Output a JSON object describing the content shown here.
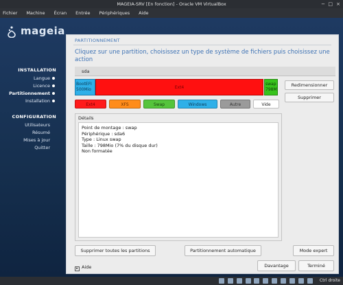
{
  "window": {
    "title": "MAGEIA-SRV [En fonction] - Oracle VM VirtualBox",
    "controls": [
      "−",
      "□",
      "×"
    ]
  },
  "menubar": {
    "items": [
      "Fichier",
      "Machine",
      "Écran",
      "Entrée",
      "Périphériques",
      "Aide"
    ]
  },
  "logo": {
    "text": "mageia"
  },
  "sidebar": {
    "installation_heading": "INSTALLATION",
    "installation_items": [
      {
        "label": "Langue",
        "state": "done"
      },
      {
        "label": "Licence",
        "state": "done"
      },
      {
        "label": "Partitionnement",
        "state": "current"
      },
      {
        "label": "Installation",
        "state": "done"
      }
    ],
    "configuration_heading": "CONFIGURATION",
    "configuration_items": [
      {
        "label": "Utilisateurs"
      },
      {
        "label": "Résumé"
      },
      {
        "label": "Mises à jour"
      },
      {
        "label": "Quitter"
      }
    ]
  },
  "panel": {
    "title": "PARTITIONNEMENT",
    "instruction": "Cliquez sur une partition, choisissez un type de système de fichiers puis choisissez une action",
    "drive_tab": "sda",
    "partitions": [
      {
        "name": "BootEFI",
        "size": "500Mio",
        "color": "#2fb0e8"
      },
      {
        "name": "/",
        "label": "Ext4",
        "color": "#ff1010"
      },
      {
        "name": "swap",
        "size": "798Mio",
        "color": "#37c31c"
      }
    ],
    "side_buttons": {
      "resize": "Redimensionner",
      "delete": "Supprimer"
    },
    "fs_types": [
      {
        "label": "Ext4",
        "color": "#ff1a1a",
        "text": "#7a0000"
      },
      {
        "label": "XFS",
        "color": "#ff8c1a",
        "text": "#6a2f00"
      },
      {
        "label": "Swap",
        "color": "#55c43b",
        "text": "#173f0c"
      },
      {
        "label": "Windows",
        "color": "#2fb0e8",
        "text": "#0b3a57"
      },
      {
        "label": "Autre",
        "color": "#9a9a9a",
        "text": "#333333"
      },
      {
        "label": "Vide",
        "color": "#ffffff",
        "text": "#222222"
      }
    ],
    "details": {
      "label": "Détails",
      "lines": [
        "Point de montage : swap",
        "Périphérique : sda6",
        "Type : Linux swap",
        "Taille : 798Mio (7% du disque dur)",
        "Non formatée"
      ]
    },
    "actions": {
      "delete_all": "Supprimer toutes les partitions",
      "auto": "Partitionnement automatique",
      "expert": "Mode expert"
    },
    "help": "Aide",
    "more": "Davantage",
    "done": "Terminé"
  },
  "statusbar": {
    "host_key": "Ctrl droite"
  }
}
